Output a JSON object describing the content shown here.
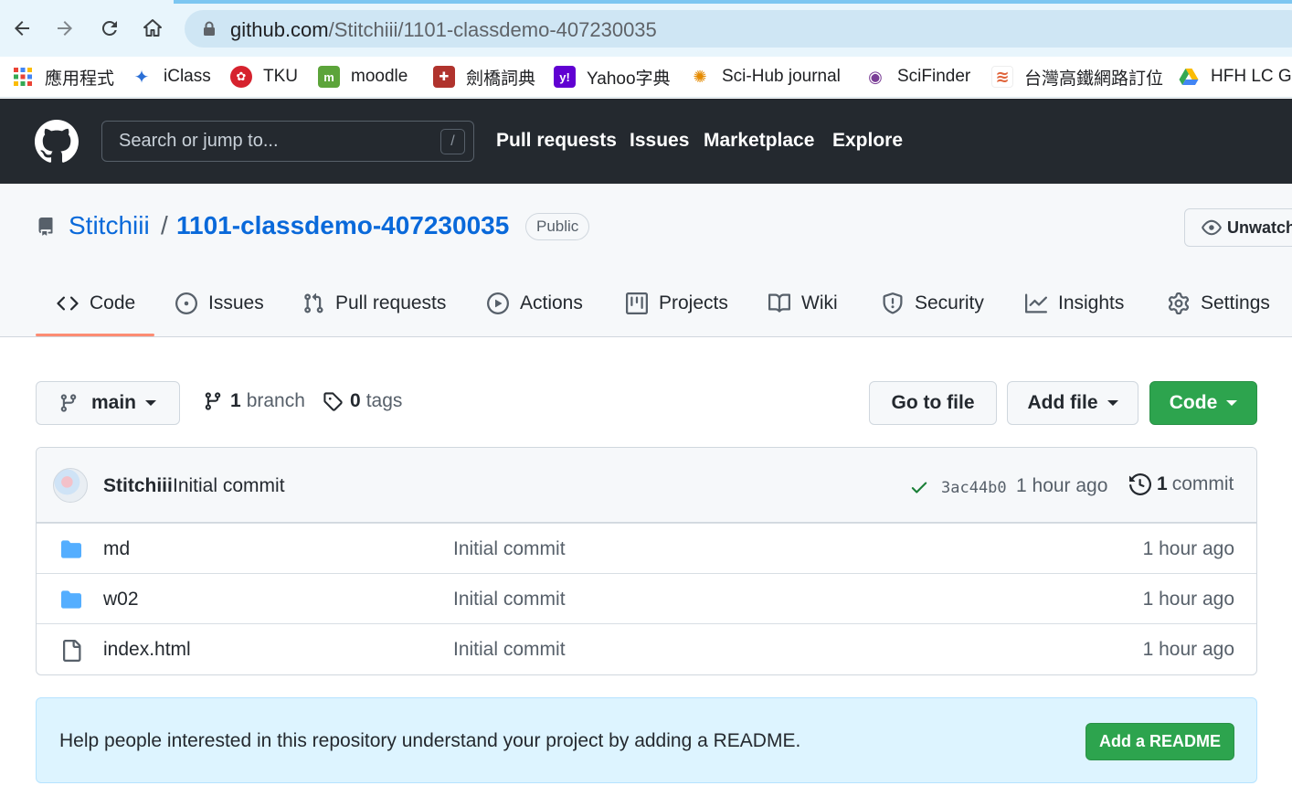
{
  "browser": {
    "url_host": "github.com",
    "url_path": "/Stitchiii/1101-classdemo-407230035",
    "bookmarks": [
      {
        "label": "應用程式",
        "icon": "apps-grid-icon"
      },
      {
        "label": "iClass",
        "icon": "iclass-icon"
      },
      {
        "label": "TKU",
        "icon": "tku-icon"
      },
      {
        "label": "moodle",
        "icon": "moodle-icon"
      },
      {
        "label": "劍橋詞典",
        "icon": "cambridge-icon"
      },
      {
        "label": "Yahoo字典",
        "icon": "yahoo-icon"
      },
      {
        "label": "Sci-Hub journal",
        "icon": "scihub-icon"
      },
      {
        "label": "SciFinder",
        "icon": "scifinder-icon"
      },
      {
        "label": "台灣高鐵網路訂位",
        "icon": "thsr-icon"
      },
      {
        "label": "HFH LC Gro",
        "icon": "google-drive-icon"
      }
    ]
  },
  "header": {
    "search_placeholder": "Search or jump to...",
    "search_shortcut": "/",
    "nav": [
      "Pull requests",
      "Issues",
      "Marketplace",
      "Explore"
    ]
  },
  "repo": {
    "owner": "Stitchiii",
    "separator": "/",
    "name": "1101-classdemo-407230035",
    "visibility": "Public",
    "unwatch_label": "Unwatch",
    "tabs": [
      {
        "label": "Code",
        "icon": "code-icon",
        "active": true
      },
      {
        "label": "Issues",
        "icon": "issue-icon"
      },
      {
        "label": "Pull requests",
        "icon": "pull-request-icon"
      },
      {
        "label": "Actions",
        "icon": "play-icon"
      },
      {
        "label": "Projects",
        "icon": "project-icon"
      },
      {
        "label": "Wiki",
        "icon": "book-icon"
      },
      {
        "label": "Security",
        "icon": "shield-icon"
      },
      {
        "label": "Insights",
        "icon": "graph-icon"
      },
      {
        "label": "Settings",
        "icon": "gear-icon"
      }
    ]
  },
  "toolbar": {
    "branch": "main",
    "branch_count": "1",
    "branch_word": "branch",
    "tag_count": "0",
    "tag_word": "tags",
    "go_to_file": "Go to file",
    "add_file": "Add file",
    "code": "Code"
  },
  "latest_commit": {
    "author": "Stitchiii",
    "message": "Initial commit",
    "sha": "3ac44b0",
    "time": "1 hour ago",
    "commit_count": "1",
    "commit_word": "commit",
    "status_color": "#1a7f37"
  },
  "files": [
    {
      "name": "md",
      "type": "folder",
      "message": "Initial commit",
      "time": "1 hour ago"
    },
    {
      "name": "w02",
      "type": "folder",
      "message": "Initial commit",
      "time": "1 hour ago"
    },
    {
      "name": "index.html",
      "type": "file",
      "message": "Initial commit",
      "time": "1 hour ago"
    }
  ],
  "readme_prompt": {
    "text": "Help people interested in this repository understand your project by adding a README.",
    "button": "Add a README"
  },
  "colors": {
    "header_bg": "#24292f",
    "link": "#0969da",
    "green_button": "#2da44e",
    "tab_underline": "#fd8c73",
    "folder": "#54aeff"
  }
}
